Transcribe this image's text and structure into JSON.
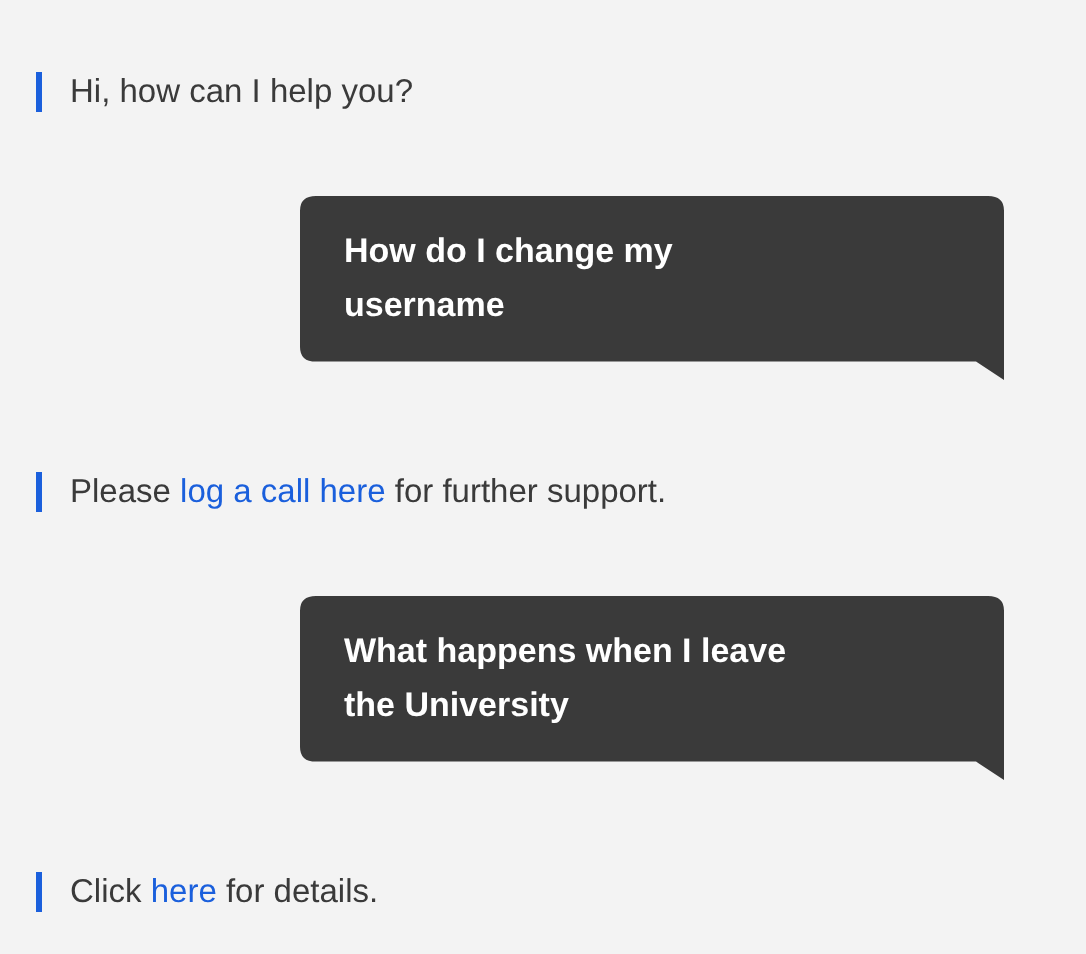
{
  "messages": [
    {
      "kind": "bot",
      "segments": [
        {
          "kind": "text",
          "text": "Hi, how can I help you?"
        }
      ]
    },
    {
      "kind": "user",
      "lines": [
        "How do I change my",
        "username"
      ]
    },
    {
      "kind": "bot",
      "segments": [
        {
          "kind": "text",
          "text": "Please "
        },
        {
          "kind": "link",
          "text": "log a call here"
        },
        {
          "kind": "text",
          "text": " for further support."
        }
      ]
    },
    {
      "kind": "user",
      "lines": [
        "What happens when I leave",
        "the University"
      ]
    },
    {
      "kind": "bot",
      "segments": [
        {
          "kind": "text",
          "text": "Click "
        },
        {
          "kind": "link",
          "text": "here"
        },
        {
          "kind": "text",
          "text": " for details."
        }
      ]
    }
  ]
}
